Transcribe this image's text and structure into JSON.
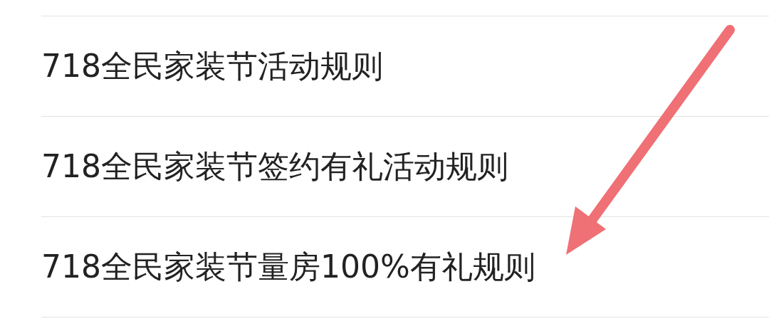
{
  "items": [
    {
      "label": "718全民家装节活动规则"
    },
    {
      "label": "718全民家装节签约有礼活动规则"
    },
    {
      "label": "718全民家装节量房100%有礼规则"
    }
  ]
}
